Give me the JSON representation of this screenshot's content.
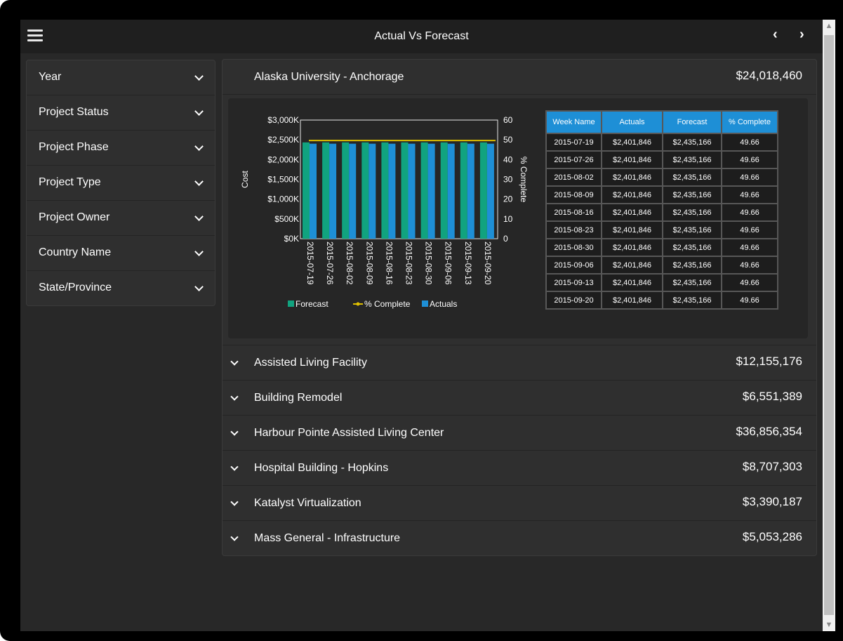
{
  "app": {
    "title": "Actual Vs Forecast",
    "prev": "‹",
    "next": "›",
    "menu_icon": "hamburger-icon"
  },
  "filters": [
    {
      "label": "Year"
    },
    {
      "label": "Project Status"
    },
    {
      "label": "Project Phase"
    },
    {
      "label": "Project Type"
    },
    {
      "label": "Project Owner"
    },
    {
      "label": "Country Name"
    },
    {
      "label": "State/Province"
    }
  ],
  "expanded_project": {
    "name": "Alaska University - Anchorage",
    "amount": "$24,018,460"
  },
  "projects": [
    {
      "name": "Assisted Living Facility",
      "amount": "$12,155,176"
    },
    {
      "name": "Building Remodel",
      "amount": "$6,551,389"
    },
    {
      "name": "Harbour Pointe Assisted Living Center",
      "amount": "$36,856,354"
    },
    {
      "name": "Hospital Building - Hopkins",
      "amount": "$8,707,303"
    },
    {
      "name": "Katalyst Virtualization",
      "amount": "$3,390,187"
    },
    {
      "name": "Mass General - Infrastructure",
      "amount": "$5,053,286"
    }
  ],
  "table": {
    "headers": [
      "Week Name",
      "Actuals",
      "Forecast",
      "% Complete"
    ],
    "rows": [
      [
        "2015-07-19",
        "$2,401,846",
        "$2,435,166",
        "49.66"
      ],
      [
        "2015-07-26",
        "$2,401,846",
        "$2,435,166",
        "49.66"
      ],
      [
        "2015-08-02",
        "$2,401,846",
        "$2,435,166",
        "49.66"
      ],
      [
        "2015-08-09",
        "$2,401,846",
        "$2,435,166",
        "49.66"
      ],
      [
        "2015-08-16",
        "$2,401,846",
        "$2,435,166",
        "49.66"
      ],
      [
        "2015-08-23",
        "$2,401,846",
        "$2,435,166",
        "49.66"
      ],
      [
        "2015-08-30",
        "$2,401,846",
        "$2,435,166",
        "49.66"
      ],
      [
        "2015-09-06",
        "$2,401,846",
        "$2,435,166",
        "49.66"
      ],
      [
        "2015-09-13",
        "$2,401,846",
        "$2,435,166",
        "49.66"
      ],
      [
        "2015-09-20",
        "$2,401,846",
        "$2,435,166",
        "49.66"
      ]
    ]
  },
  "chart_data": {
    "type": "bar",
    "categories": [
      "2015-07-19",
      "2015-07-26",
      "2015-08-02",
      "2015-08-09",
      "2015-08-16",
      "2015-08-23",
      "2015-08-30",
      "2015-09-06",
      "2015-09-13",
      "2015-09-20"
    ],
    "series": [
      {
        "name": "Forecast",
        "type": "bar",
        "axis": "left",
        "color": "#11a37f",
        "values": [
          2435166,
          2435166,
          2435166,
          2435166,
          2435166,
          2435166,
          2435166,
          2435166,
          2435166,
          2435166
        ]
      },
      {
        "name": "Actuals",
        "type": "bar",
        "axis": "left",
        "color": "#1e8fd6",
        "values": [
          2401846,
          2401846,
          2401846,
          2401846,
          2401846,
          2401846,
          2401846,
          2401846,
          2401846,
          2401846
        ]
      },
      {
        "name": "% Complete",
        "type": "line",
        "axis": "right",
        "color": "#e0c000",
        "values": [
          49.66,
          49.66,
          49.66,
          49.66,
          49.66,
          49.66,
          49.66,
          49.66,
          49.66,
          49.66
        ]
      }
    ],
    "ylabel": "Cost",
    "y2label": "% Complete",
    "ylim": [
      0,
      3000000
    ],
    "y2lim": [
      0,
      60
    ],
    "yticks": [
      "$0K",
      "$500K",
      "$1,000K",
      "$1,500K",
      "$2,000K",
      "$2,500K",
      "$3,000K"
    ],
    "y2ticks": [
      "0",
      "10",
      "20",
      "30",
      "40",
      "50",
      "60"
    ],
    "legend": [
      "Forecast",
      "% Complete",
      "Actuals"
    ],
    "legend_position": "bottom",
    "grid": false
  }
}
